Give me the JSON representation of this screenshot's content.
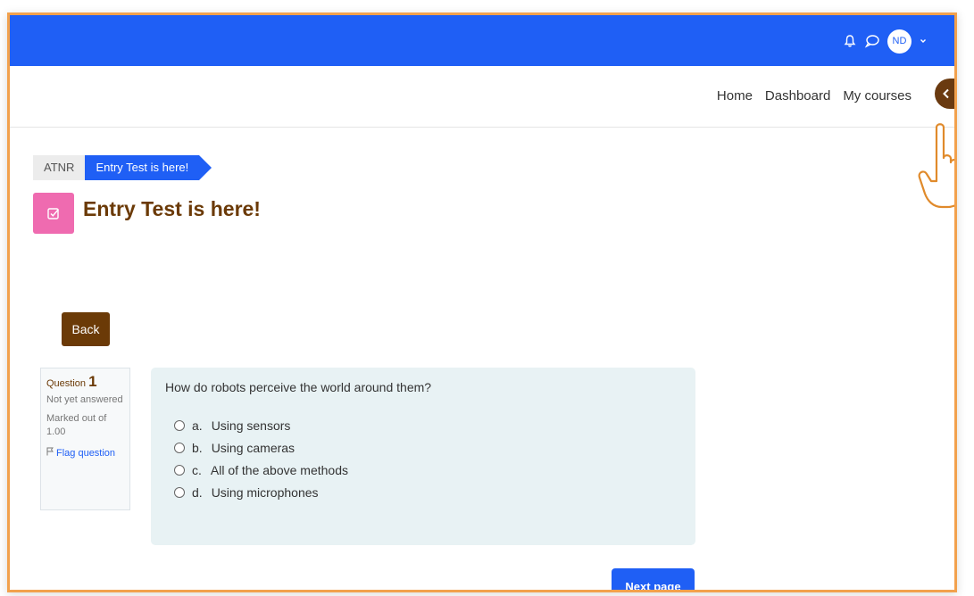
{
  "header": {
    "avatar_initials": "ND",
    "accent_color": "#1f5ff5"
  },
  "nav": {
    "links": [
      "Home",
      "Dashboard",
      "My courses"
    ]
  },
  "breadcrumb": {
    "course": "ATNR",
    "current": "Entry Test is here!"
  },
  "page": {
    "title": "Entry Test is here!",
    "back_label": "Back",
    "activity_icon": "quiz-icon"
  },
  "question": {
    "label": "Question",
    "number": "1",
    "state": "Not yet answered",
    "grade": "Marked out of 1.00",
    "flag_label": "Flag question",
    "text": "How do robots perceive the world around them?",
    "answers": [
      {
        "letter": "a.",
        "text": "Using sensors"
      },
      {
        "letter": "b.",
        "text": "Using cameras"
      },
      {
        "letter": "c.",
        "text": "All of the above methods"
      },
      {
        "letter": "d.",
        "text": "Using microphones"
      }
    ]
  },
  "footer": {
    "next_label": "Next page"
  },
  "colors": {
    "brand_brown": "#6b3a07",
    "frame_orange": "#f2a14d",
    "quiz_pink": "#ef6bb0"
  }
}
